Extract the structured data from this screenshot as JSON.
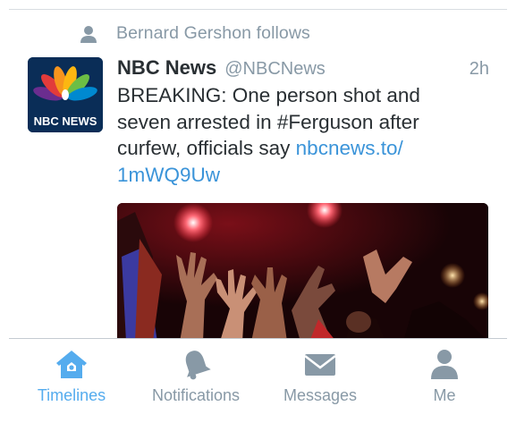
{
  "timeline": {
    "social_context": "Bernard Gershon follows",
    "tweet": {
      "author_name": "NBC News",
      "handle": "@NBCNews",
      "time": "2h",
      "text": "BREAKING: One person shot and seven arrested in #Ferguson after curfew, officials say ",
      "link": "nbcnews.to/​1mWQ9Uw",
      "avatar_text": "NBC NEWS"
    }
  },
  "tabbar": {
    "active_color": "#55acee",
    "inactive_color": "#8899a6",
    "tabs": [
      {
        "label": "Timelines",
        "icon": "home-icon",
        "active": true
      },
      {
        "label": "Notifications",
        "icon": "bell-icon",
        "active": false
      },
      {
        "label": "Messages",
        "icon": "envelope-icon",
        "active": false
      },
      {
        "label": "Me",
        "icon": "person-icon",
        "active": false
      }
    ]
  }
}
